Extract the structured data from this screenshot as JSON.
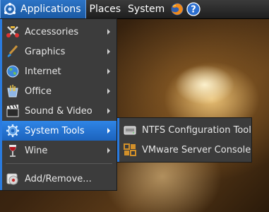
{
  "panel": {
    "applications_label": "Applications",
    "places_label": "Places",
    "system_label": "System"
  },
  "main_menu": {
    "items": [
      {
        "label": "Accessories",
        "icon": "accessories-icon",
        "has_submenu": true
      },
      {
        "label": "Graphics",
        "icon": "graphics-icon",
        "has_submenu": true
      },
      {
        "label": "Internet",
        "icon": "internet-icon",
        "has_submenu": true
      },
      {
        "label": "Office",
        "icon": "office-icon",
        "has_submenu": true
      },
      {
        "label": "Sound & Video",
        "icon": "sound-video-icon",
        "has_submenu": true
      },
      {
        "label": "System Tools",
        "icon": "system-tools-icon",
        "has_submenu": true,
        "selected": true
      },
      {
        "label": "Wine",
        "icon": "wine-icon",
        "has_submenu": true
      }
    ],
    "add_remove_label": "Add/Remove..."
  },
  "sub_menu": {
    "items": [
      {
        "label": "NTFS Configuration Tool",
        "icon": "drive-icon"
      },
      {
        "label": "VMware Server Console",
        "icon": "vmware-icon"
      }
    ]
  },
  "colors": {
    "accent": "#2a7be0",
    "menu_bg": "#3c3c3c",
    "panel_bg": "#2a2a2a"
  }
}
